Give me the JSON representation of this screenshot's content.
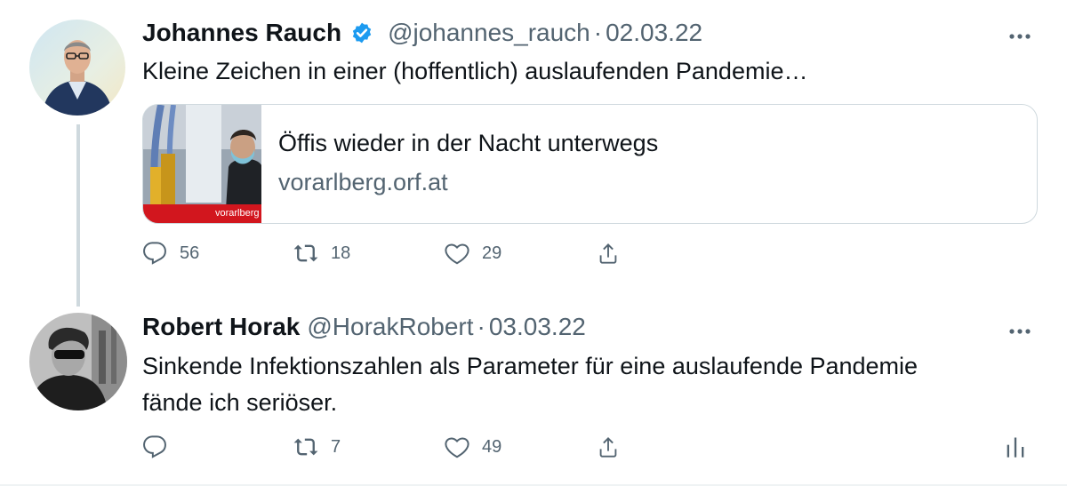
{
  "tweets": [
    {
      "name": "Johannes Rauch",
      "handle": "@johannes_rauch",
      "separator": "·",
      "date": "02.03.22",
      "text": "Kleine Zeichen in einer (hoffentlich) auslaufenden Pandemie…",
      "card": {
        "title": "Öffis wieder in der Nacht unterwegs",
        "domain": "vorarlberg.orf.at",
        "thumb_caption": "vorarlberg"
      },
      "actions": {
        "replies": "56",
        "retweets": "18",
        "likes": "29"
      }
    },
    {
      "name": "Robert Horak",
      "handle": "@HorakRobert",
      "separator": "·",
      "date": "03.03.22",
      "text_line1": "Sinkende Infektionszahlen als Parameter für eine auslaufende Pandemie",
      "text_line2": "fände ich seriöser.",
      "actions": {
        "replies": "",
        "retweets": "7",
        "likes": "49"
      }
    }
  ],
  "icons": {
    "more": "more-dots-icon",
    "verified": "verified-badge-icon",
    "reply": "reply-icon",
    "retweet": "retweet-icon",
    "like": "like-icon",
    "share": "share-icon",
    "analytics": "analytics-icon"
  },
  "colors": {
    "verified": "#1d9bf0",
    "text_secondary": "#536471",
    "border": "#cfd9de",
    "thumb_red": "#d2161e"
  }
}
